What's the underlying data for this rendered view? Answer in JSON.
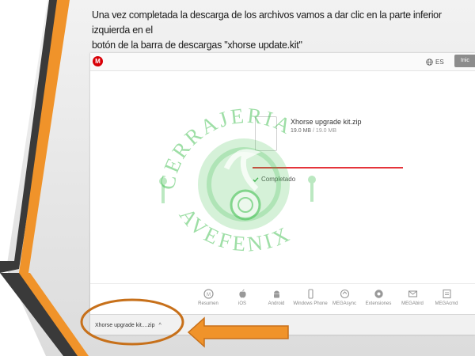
{
  "slide": {
    "instruction_line1": "Una vez completada la descarga de los archivos vamos a dar clic en la parte inferior izquierda en el",
    "instruction_line2": "botón de la barra de descargas \"xhorse update.kit\""
  },
  "browser": {
    "logo_letter": "M",
    "language_label": "ES",
    "login_label": "Inic"
  },
  "transfer": {
    "file_name": "Xhorse upgrade kit.zip",
    "downloaded": "19.0 MB",
    "separator": " / ",
    "total": "19.0 MB",
    "progress_percent": 100,
    "status": "Completado"
  },
  "watermark": {
    "line1": "CERRAJERIA",
    "line2": "AVEFENIX"
  },
  "apps": [
    {
      "label": "Resumen",
      "icon": "mega-icon"
    },
    {
      "label": "iOS",
      "icon": "apple-icon"
    },
    {
      "label": "Android",
      "icon": "android-icon"
    },
    {
      "label": "Windows Phone",
      "icon": "windows-phone-icon"
    },
    {
      "label": "MEGAsync",
      "icon": "sync-icon"
    },
    {
      "label": "Extensiones",
      "icon": "extensions-icon"
    },
    {
      "label": "MEGAbird",
      "icon": "mail-icon"
    },
    {
      "label": "MEGAcmd",
      "icon": "terminal-icon"
    }
  ],
  "download_bar": {
    "item_label": "Xhorse upgrade kit....zip",
    "chevron": "^"
  },
  "colors": {
    "accent_red": "#d90007",
    "progress_red": "#e5343b",
    "watermark_green": "#3fbf4f",
    "callout_orange": "#d97e1a",
    "slide_stripe_orange": "#f0932a",
    "slide_stripe_dark": "#3a3a3a"
  }
}
